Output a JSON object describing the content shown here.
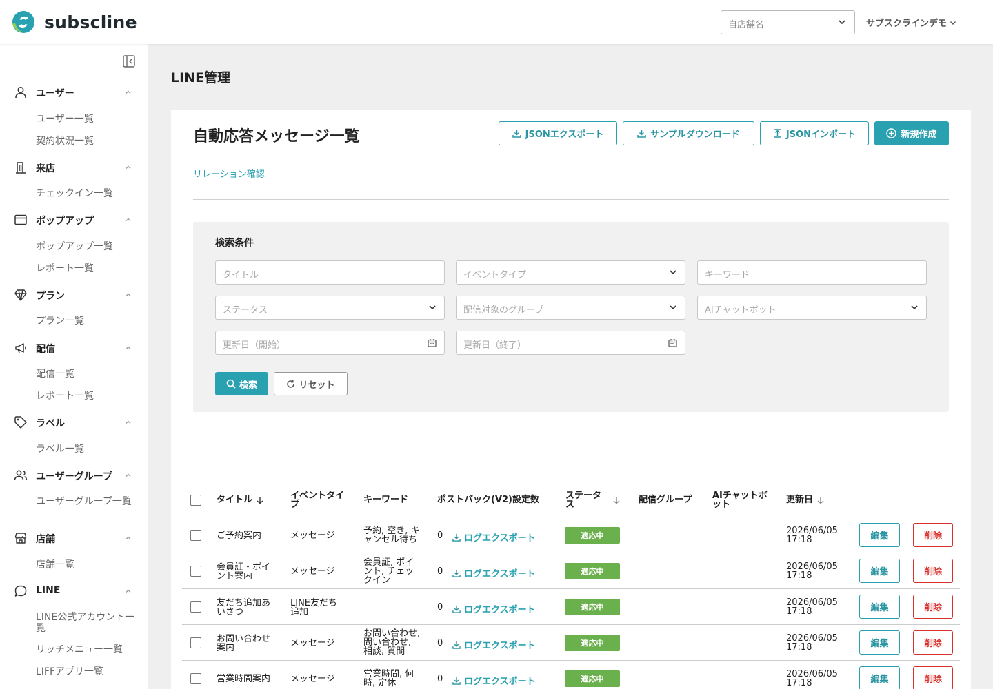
{
  "app": {
    "logo_text": "subscline",
    "store_select_placeholder": "自店舗名",
    "user_menu_label": "サブスクラインデモ"
  },
  "sidebar": {
    "groups": [
      {
        "label": "ユーザー",
        "icon": "user-icon",
        "items": [
          "ユーザー一覧",
          "契約状況一覧"
        ]
      },
      {
        "label": "来店",
        "icon": "building-icon",
        "items": [
          "チェックイン一覧"
        ]
      },
      {
        "label": "ポップアップ",
        "icon": "window-icon",
        "items": [
          "ポップアップ一覧",
          "レポート一覧"
        ]
      },
      {
        "label": "プラン",
        "icon": "diamond-icon",
        "items": [
          "プラン一覧"
        ]
      },
      {
        "label": "配信",
        "icon": "megaphone-icon",
        "items": [
          "配信一覧",
          "レポート一覧"
        ]
      },
      {
        "label": "ラベル",
        "icon": "tag-icon",
        "items": [
          "ラベル一覧"
        ]
      },
      {
        "label": "ユーザーグループ",
        "icon": "users-icon",
        "items": [
          "ユーザーグループ一覧"
        ]
      },
      {
        "label": "店舗",
        "icon": "store-icon",
        "items": [
          "店舗一覧"
        ]
      },
      {
        "label": "LINE",
        "icon": "chat-bubble-icon",
        "items": [
          "LINE公式アカウント一覧",
          "リッチメニュー一覧",
          "LIFFアプリ一覧"
        ]
      }
    ]
  },
  "main": {
    "page_title": "LINE管理",
    "card_title": "自動応答メッセージ一覧",
    "buttons": {
      "json_export": "JSONエクスポート",
      "sample_download": "サンプルダウンロード",
      "json_import": "JSONインポート",
      "create_new": "新規作成"
    },
    "relation_link": "リレーション確認",
    "search": {
      "heading": "検索条件",
      "title_placeholder": "タイトル",
      "event_type_placeholder": "イベントタイプ",
      "keyword_placeholder": "キーワード",
      "status_placeholder": "ステータス",
      "group_placeholder": "配信対象のグループ",
      "ai_chatbot_placeholder": "AIチャットボット",
      "updated_start_placeholder": "更新日（開始）",
      "updated_end_placeholder": "更新日（終了）",
      "search_button": "検索",
      "reset_button": "リセット"
    },
    "table": {
      "headers": {
        "title": "タイトル",
        "event_type": "イベントタイプ",
        "keyword": "キーワード",
        "postback_count": "ポストバック(V2)設定数",
        "status": "ステータス",
        "delivery_group": "配信グループ",
        "ai_chatbot": "AIチャットボット",
        "updated_at": "更新日"
      },
      "log_export_label": "ログエクスポート",
      "edit_label": "編集",
      "delete_label": "削除",
      "rows": [
        {
          "title": "ご予約案内",
          "event_type": "メッセージ",
          "keyword": "予約, 空き, キャンセル待ち",
          "postback_count": "0",
          "status": "適応中",
          "delivery_group": "",
          "ai_chatbot": "",
          "updated_at": "2026/06/05 17:18"
        },
        {
          "title": "会員証・ポイント案内",
          "event_type": "メッセージ",
          "keyword": "会員証, ポイント, チェックイン",
          "postback_count": "0",
          "status": "適応中",
          "delivery_group": "",
          "ai_chatbot": "",
          "updated_at": "2026/06/05 17:18"
        },
        {
          "title": "友だち追加あいさつ",
          "event_type": "LINE友だち追加",
          "keyword": "",
          "postback_count": "0",
          "status": "適応中",
          "delivery_group": "",
          "ai_chatbot": "",
          "updated_at": "2026/06/05 17:18"
        },
        {
          "title": "お問い合わせ案内",
          "event_type": "メッセージ",
          "keyword": "お問い合わせ, 問い合わせ, 相談, 質問",
          "postback_count": "0",
          "status": "適応中",
          "delivery_group": "",
          "ai_chatbot": "",
          "updated_at": "2026/06/05 17:18"
        },
        {
          "title": "営業時間案内",
          "event_type": "メッセージ",
          "keyword": "営業時間, 何時, 定休",
          "postback_count": "0",
          "status": "適応中",
          "delivery_group": "",
          "ai_chatbot": "",
          "updated_at": "2026/06/05 17:18"
        }
      ]
    }
  },
  "colors": {
    "accent": "#2aa1b0",
    "danger": "#d9302c",
    "status_active": "#6ab04c"
  }
}
